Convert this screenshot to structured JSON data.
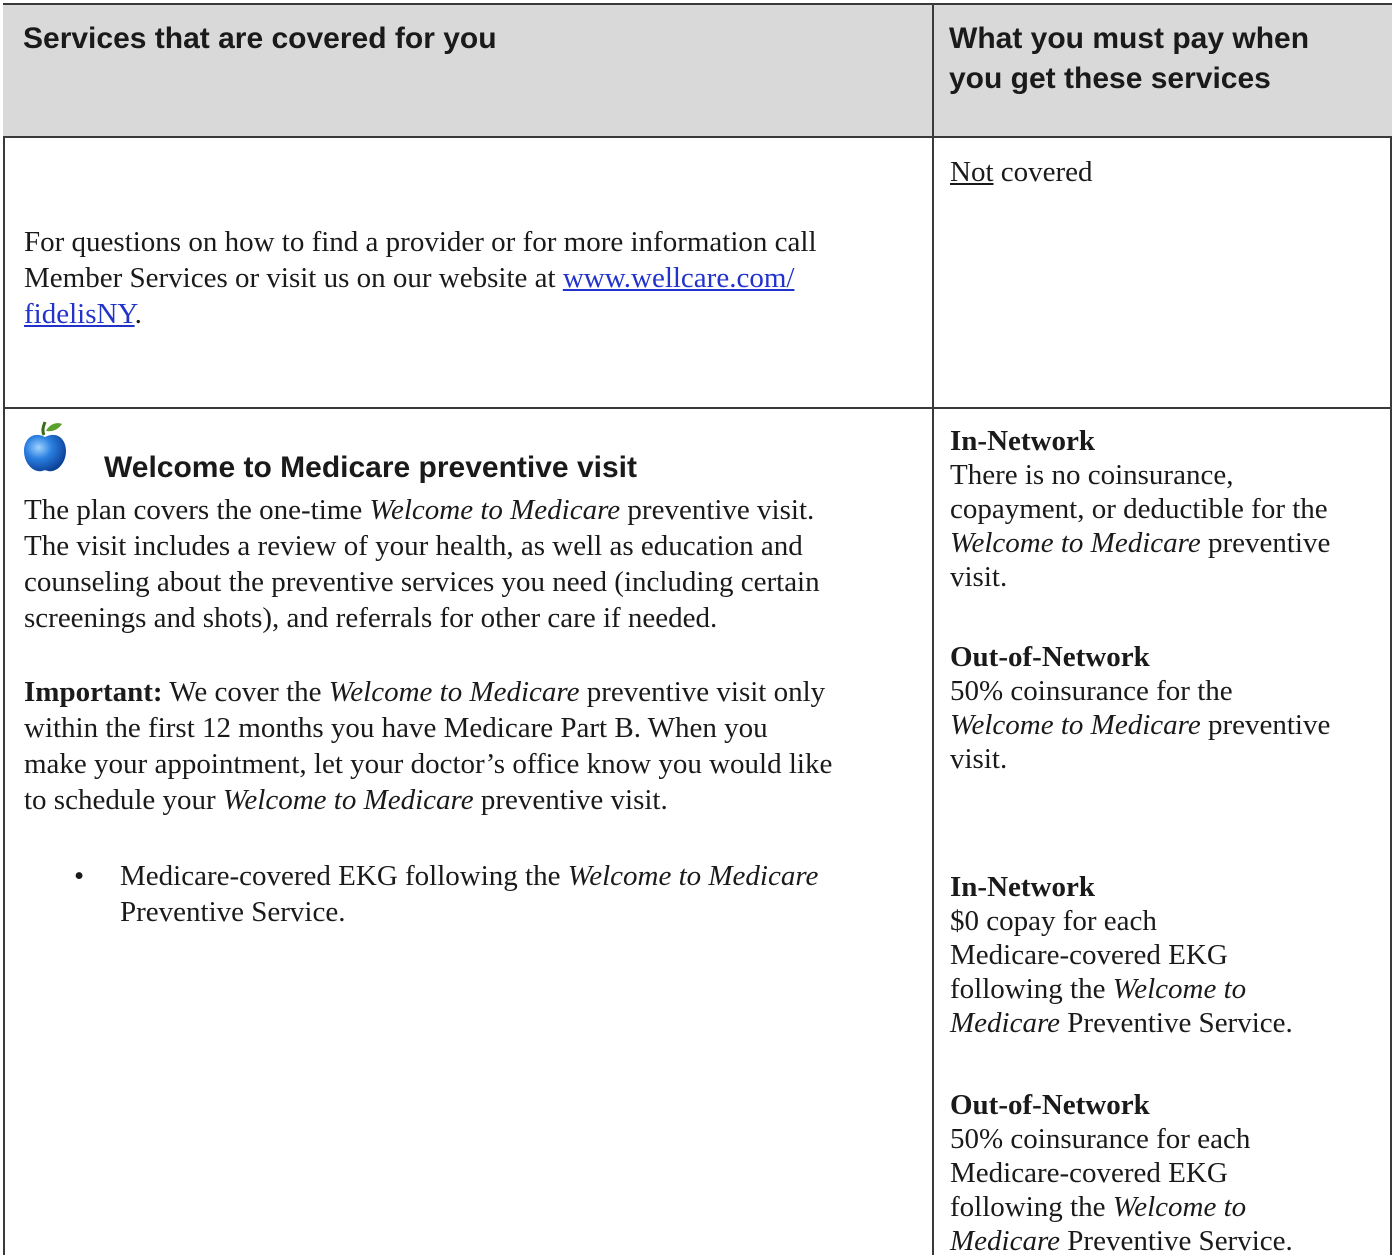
{
  "header": {
    "col1": "Services that are covered for you",
    "col2_line1": "What you must pay when",
    "col2_line2": "you get these services"
  },
  "row1": {
    "left_text_1": "For questions on how to find a provider or for more information call",
    "left_text_2": "Member Services or visit us on our website at ",
    "link_part1": "www.wellcare.com/",
    "link_part2": "fidelisNY",
    "link_trail": ".",
    "right_not": "Not",
    "right_rest": " covered"
  },
  "row2": {
    "icon": "apple-icon",
    "title": "Welcome to Medicare preventive visit",
    "p1_a": "The plan covers the one-time ",
    "p1_i": "Welcome to Medicare",
    "p1_b": " preventive visit.",
    "p1_l2": "The visit includes a review of your health, as well as education and",
    "p1_l3": "counseling about the preventive services you need (including certain",
    "p1_l4": "screenings and shots), and referrals for other care if needed.",
    "p2_bold": "Important:",
    "p2_a": " We cover the ",
    "p2_i": "Welcome to Medicare",
    "p2_b": " preventive visit only",
    "p2_l2": "within the first 12 months you have Medicare Part B. When you",
    "p2_l3": "make your appointment, let your doctor’s office know you would like",
    "p2_l4_a": "to schedule your ",
    "p2_l4_i": "Welcome to Medicare",
    "p2_l4_b": " preventive visit.",
    "bullet": "•",
    "bullet_a": "Medicare-covered EKG following the ",
    "bullet_i": "Welcome to Medicare",
    "bullet_l2": "Preventive Service.",
    "r_in1_head": "In-Network",
    "r_in1_l1": "There is no coinsurance,",
    "r_in1_l2": "copayment, or deductible for the",
    "r_in1_l3_i": "Welcome to Medicare",
    "r_in1_l3_b": " preventive",
    "r_in1_l4": "visit.",
    "r_out1_head": "Out-of-Network",
    "r_out1_l1": "50% coinsurance for the",
    "r_out1_l2_i": "Welcome to Medicare",
    "r_out1_l2_b": " preventive",
    "r_out1_l3": "visit.",
    "r_in2_head": "In-Network",
    "r_in2_l1": "$0 copay for each",
    "r_in2_l2": "Medicare-covered EKG",
    "r_in2_l3_a": "following the ",
    "r_in2_l3_i": "Welcome to",
    "r_in2_l4_i": "Medicare",
    "r_in2_l4_b": " Preventive Service.",
    "r_out2_head": "Out-of-Network",
    "r_out2_l1": "50% coinsurance for each",
    "r_out2_l2": "Medicare-covered EKG",
    "r_out2_l3_a": "following the ",
    "r_out2_l3_i": "Welcome to",
    "r_out2_l4_i": "Medicare",
    "r_out2_l4_b": " Preventive Service."
  },
  "colors": {
    "header_bg": "#d9d9d9",
    "link": "#2233cc",
    "border": "#3a3a3a"
  }
}
